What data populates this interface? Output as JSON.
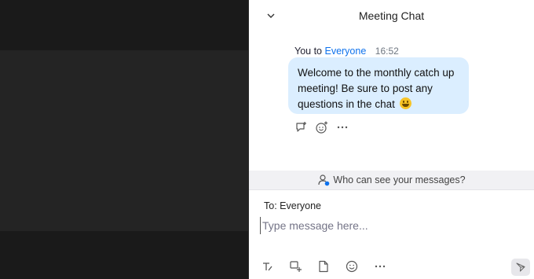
{
  "header": {
    "title": "Meeting Chat"
  },
  "message": {
    "sender": "You to",
    "recipient": "Everyone",
    "time": "16:52",
    "text": "Welcome to the monthly catch up meeting! Be sure to post any questions in the chat",
    "emoji": "grinning-face-emoji"
  },
  "privacy": {
    "label": "Who can see your messages?"
  },
  "composer": {
    "to_label": "To:",
    "to_value": "Everyone",
    "placeholder": "Type message here..."
  },
  "colors": {
    "accent": "#0e72ed",
    "bubble": "#dbeeff",
    "video_bg": "#1a1a1a",
    "video_tile": "#242424"
  },
  "icons": {
    "collapse": "chevron-down-icon",
    "reply": "reply-icon",
    "react": "add-reaction-icon",
    "more": "more-icon",
    "privacy": "person-visibility-icon",
    "format": "format-text-icon",
    "screenshot": "screenshot-icon",
    "file": "file-icon",
    "emoji": "emoji-icon",
    "send": "send-icon"
  }
}
